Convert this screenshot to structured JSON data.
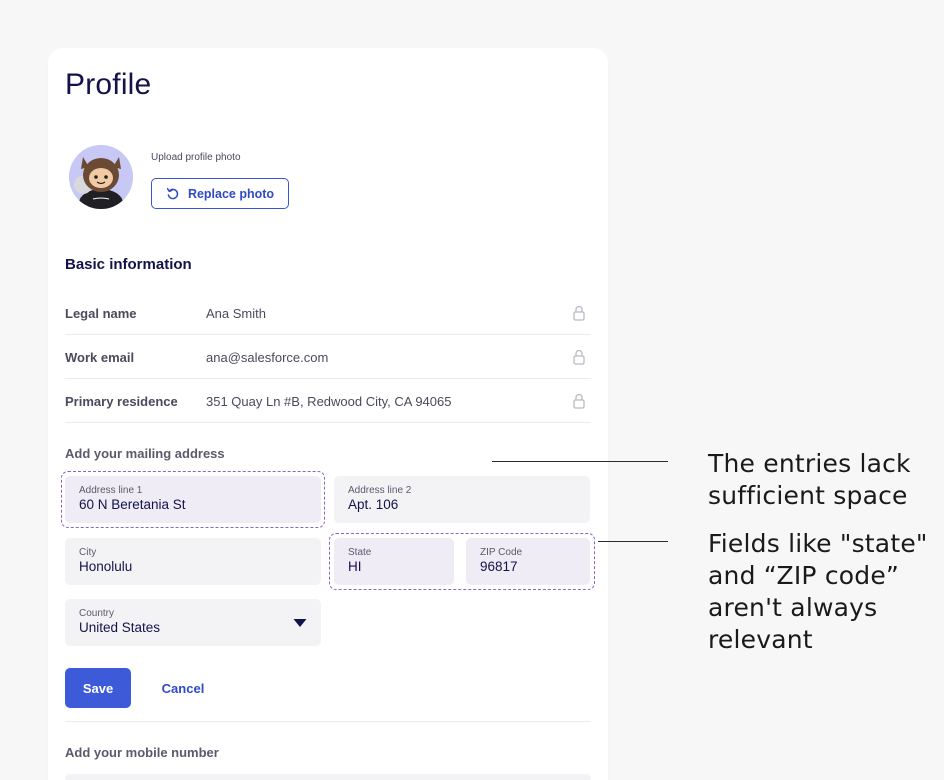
{
  "profile": {
    "title": "Profile",
    "upload_label": "Upload profile photo",
    "replace_photo_label": "Replace photo"
  },
  "basic_info": {
    "title": "Basic information",
    "rows": [
      {
        "label": "Legal name",
        "value": "Ana Smith"
      },
      {
        "label": "Work email",
        "value": "ana@salesforce.com"
      },
      {
        "label": "Primary residence",
        "value": "351 Quay Ln #B, Redwood City, CA 94065"
      }
    ]
  },
  "mailing": {
    "title": "Add your mailing address",
    "address1": {
      "label": "Address line 1",
      "value": "60 N Beretania St"
    },
    "address2": {
      "label": "Address line 2",
      "value": "Apt. 106"
    },
    "city": {
      "label": "City",
      "value": "Honolulu"
    },
    "state": {
      "label": "State",
      "value": "HI"
    },
    "zip": {
      "label": "ZIP Code",
      "value": "96817"
    },
    "country": {
      "label": "Country",
      "value": "United States"
    },
    "save_label": "Save",
    "cancel_label": "Cancel"
  },
  "mobile": {
    "title": "Add your mobile number"
  },
  "annotations": {
    "note1": [
      "The entries lack",
      "sufficient space"
    ],
    "note2": [
      "Fields like \"state\"",
      "and “ZIP code”",
      "aren't always",
      "relevant"
    ]
  },
  "colors": {
    "accent": "#3d5bd9",
    "highlight_border": "#8e63c7",
    "title": "#14124a"
  },
  "icons": [
    "avatar-image",
    "refresh-icon",
    "lock-icon",
    "caret-down-icon"
  ]
}
